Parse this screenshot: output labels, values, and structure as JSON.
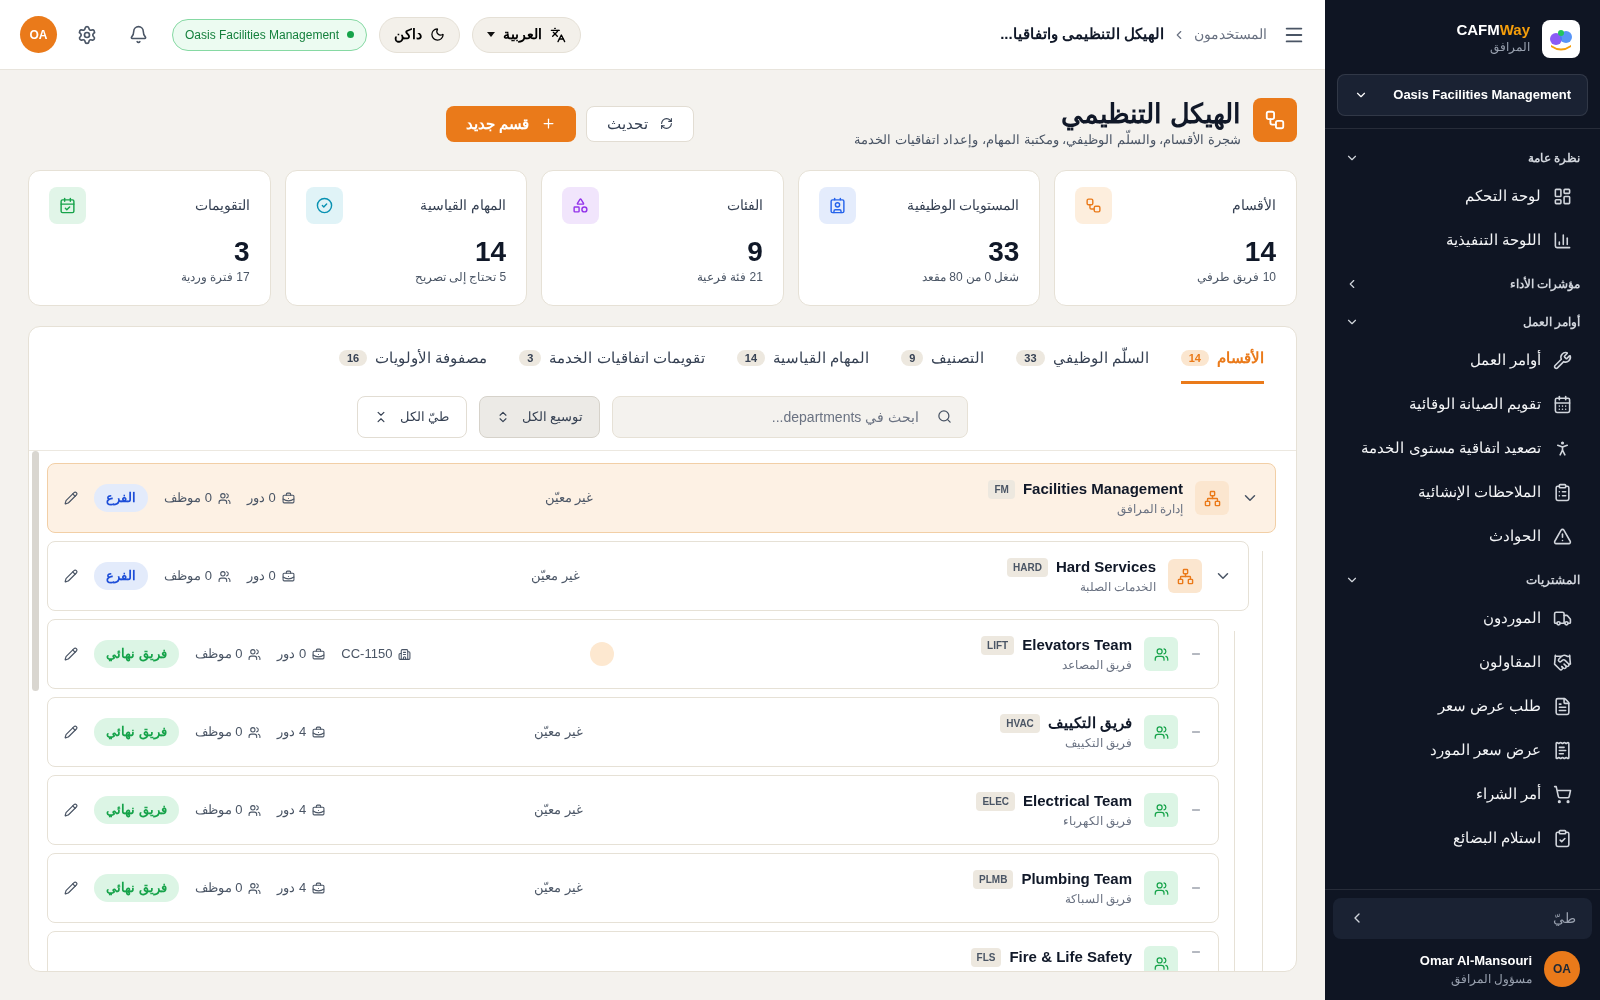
{
  "sidebar": {
    "brand": {
      "main": "CAFM",
      "accent": "Way",
      "subtitle": "المرافق"
    },
    "tenant": "Oasis Facilities Management",
    "sections": [
      {
        "title": "نظرة عامة",
        "expanded": true,
        "items": [
          {
            "label": "لوحة التحكم"
          },
          {
            "label": "اللوحة التنفيذية"
          }
        ]
      },
      {
        "title": "مؤشرات الأداء",
        "expanded": false
      },
      {
        "title": "أوامر العمل",
        "expanded": true,
        "items": [
          {
            "label": "أوامر العمل"
          },
          {
            "label": "تقويم الصيانة الوقائية"
          },
          {
            "label": "تصعيد اتفاقية مستوى الخدمة"
          },
          {
            "label": "الملاحظات الإنشائية"
          },
          {
            "label": "الحوادث"
          }
        ]
      },
      {
        "title": "المشتريات",
        "expanded": true,
        "items": [
          {
            "label": "الموردون"
          },
          {
            "label": "المقاولون"
          },
          {
            "label": "طلب عرض سعر"
          },
          {
            "label": "عرض سعر المورد"
          },
          {
            "label": "أمر الشراء"
          },
          {
            "label": "استلام البضائع"
          }
        ]
      }
    ],
    "collapse": "طيّ",
    "user": {
      "name": "Omar Al-Mansouri",
      "role": "مسؤول المرافق",
      "initials": "OA"
    }
  },
  "topbar": {
    "breadcrumb": [
      "المستخدمون",
      "الهيكل التنظيمى واتفاقيا..."
    ],
    "language": "العربية",
    "theme": "داكن",
    "tenant": "Oasis Facilities Management",
    "initials": "OA"
  },
  "header": {
    "title": "الهيكل التنظيمي",
    "subtitle": "شجرة الأقسام، والسلّم الوظيفي، ومكتبة المهام، وإعداد اتفاقيات الخدمة",
    "refresh": "تحديث",
    "new": "قسم جديد"
  },
  "stats": [
    {
      "label": "الأقسام",
      "value": "14",
      "sub": "10 فريق طرفي"
    },
    {
      "label": "المستويات الوظيفية",
      "value": "33",
      "sub": "شغل 0 من 80 مقعد"
    },
    {
      "label": "الفئات",
      "value": "9",
      "sub": "21 فئة فرعية"
    },
    {
      "label": "المهام القياسية",
      "value": "14",
      "sub": "5 تحتاج إلى تصريح"
    },
    {
      "label": "التقويمات",
      "value": "3",
      "sub": "17 فترة وردية"
    }
  ],
  "tabs": [
    {
      "label": "الأقسام",
      "count": "14",
      "selected": true
    },
    {
      "label": "السلّم الوظيفي",
      "count": "33",
      "selected": false
    },
    {
      "label": "التصنيف",
      "count": "9",
      "selected": false
    },
    {
      "label": "المهام القياسية",
      "count": "14",
      "selected": false
    },
    {
      "label": "تقويمات اتفاقيات الخدمة",
      "count": "3",
      "selected": false
    },
    {
      "label": "مصفوفة الأولويات",
      "count": "16",
      "selected": false
    }
  ],
  "search": {
    "placeholder": "ابحث في departments...",
    "expand_all": "توسيع الكل",
    "collapse_all": "طيّ الكل"
  },
  "tree": [
    {
      "kind": "branch",
      "name": "Facilities Management",
      "code": "FM",
      "subtitle": "إدارة المرافق",
      "manager": "غير معيّن",
      "roles": "0 دور",
      "staff": "0 موظف",
      "badge": "الفرع",
      "expanded": true,
      "selected": true,
      "children": [
        {
          "kind": "branch",
          "name": "Hard Services",
          "code": "HARD",
          "subtitle": "الخدمات الصلبة",
          "manager": "غير معيّن",
          "roles": "0 دور",
          "staff": "0 موظف",
          "badge": "الفرع",
          "expanded": true,
          "selected": false,
          "children": [
            {
              "kind": "team",
              "name": "Elevators Team",
              "code": "LIFT",
              "subtitle": "فريق المصاعد",
              "cost_center": "CC-1150",
              "roles": "0 دور",
              "staff": "0 موظف",
              "badge": "فريق نهائي",
              "selected": false
            },
            {
              "kind": "team",
              "name": "فريق التكييف",
              "code": "HVAC",
              "subtitle": "فريق التكييف",
              "manager": "غير معيّن",
              "roles": "4 دور",
              "staff": "0 موظف",
              "badge": "فريق نهائي",
              "selected": false
            },
            {
              "kind": "team",
              "name": "Electrical Team",
              "code": "ELEC",
              "subtitle": "فريق الكهرباء",
              "manager": "غير معيّن",
              "roles": "4 دور",
              "staff": "0 موظف",
              "badge": "فريق نهائي",
              "selected": false
            },
            {
              "kind": "team",
              "name": "Plumbing Team",
              "code": "PLMB",
              "subtitle": "فريق السباكة",
              "manager": "غير معيّن",
              "roles": "4 دور",
              "staff": "0 موظف",
              "badge": "فريق نهائي",
              "selected": false
            },
            {
              "kind": "team",
              "name": "Fire & Life Safety",
              "code": "FLS",
              "selected": false
            }
          ]
        }
      ]
    }
  ]
}
